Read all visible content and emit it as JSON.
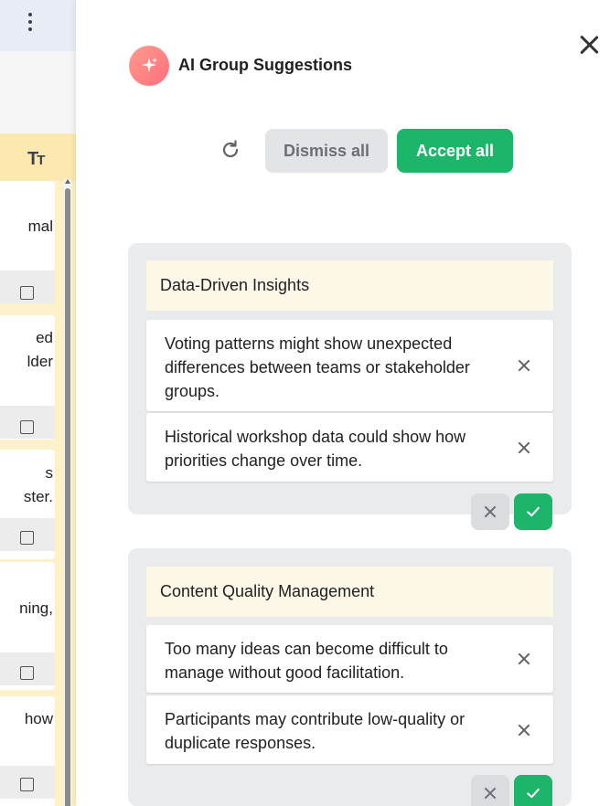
{
  "left_board": {
    "card_fragments": [
      {
        "lines": [
          "",
          "mal",
          ""
        ]
      },
      {
        "lines": [
          "ed",
          "lder",
          ""
        ]
      },
      {
        "lines": [
          "s",
          "ster."
        ]
      },
      {
        "lines": [
          "",
          "ning,",
          ""
        ]
      },
      {
        "lines": [
          "how"
        ]
      }
    ]
  },
  "panel": {
    "title": "AI Group Suggestions",
    "dismiss_all_label": "Dismiss all",
    "accept_all_label": "Accept all"
  },
  "groups": [
    {
      "title": "Data-Driven Insights",
      "items": [
        {
          "text": "Voting patterns might show unexpected differences between teams or stakeholder groups."
        },
        {
          "text": "Historical workshop data could show how priorities change over time."
        }
      ]
    },
    {
      "title": "Content Quality Management",
      "items": [
        {
          "text": "Too many ideas can become difficult to manage without good facilitation."
        },
        {
          "text": "Participants may contribute low-quality or duplicate responses."
        }
      ]
    }
  ],
  "colors": {
    "accent_green": "#1db56a",
    "dismiss_gray": "#e2e4e8",
    "group_bg": "#eaebed",
    "group_title_bg": "#fdf7e8",
    "column_yellow": "#fde8b0"
  },
  "icons": [
    "more-vert-icon",
    "text-size-icon",
    "close-icon",
    "sparkle-icon",
    "refresh-icon",
    "remove-icon",
    "check-icon"
  ]
}
